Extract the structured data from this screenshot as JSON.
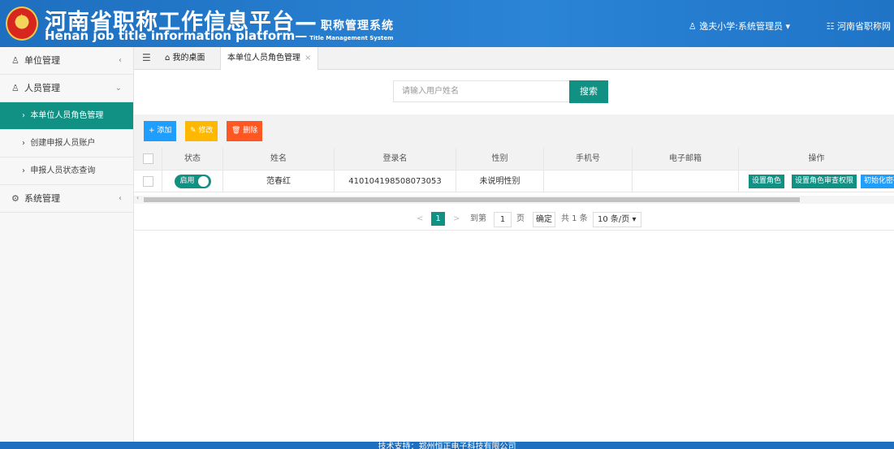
{
  "header": {
    "title_cn": "河南省职称工作信息平台—",
    "subtitle_cn": "职称管理系统",
    "title_en": "Henan job title information platform—",
    "subtitle_en": "Title Management System",
    "user": "逸夫小学:系统管理员",
    "site_link": "河南省职称网"
  },
  "sidebar": {
    "items": [
      {
        "label": "单位管理",
        "icon": "user-icon",
        "arrow": "‹"
      },
      {
        "label": "人员管理",
        "icon": "user-icon",
        "arrow": "⌄"
      },
      {
        "label": "本单位人员角色管理",
        "active": true
      },
      {
        "label": "创建申报人员账户"
      },
      {
        "label": "申报人员状态查询"
      },
      {
        "label": "系统管理",
        "icon": "settings-icon",
        "arrow": "‹"
      }
    ]
  },
  "tabs": {
    "home": "我的桌面",
    "current": "本单位人员角色管理",
    "close": "×"
  },
  "search": {
    "placeholder": "请输入用户姓名",
    "button": "搜索"
  },
  "toolbar": {
    "add": "+ 添加",
    "edit": "✎ 修改",
    "delete": "🗑 删除"
  },
  "table": {
    "headers": [
      "状态",
      "姓名",
      "登录名",
      "性别",
      "手机号",
      "电子邮箱",
      "操作"
    ],
    "rows": [
      {
        "status": "启用",
        "name": "范春红",
        "login": "410104198508073053",
        "gender": "未说明性别",
        "phone": "",
        "email": "",
        "actions": [
          "设置角色",
          "设置角色审查权限",
          "初始化密码"
        ]
      }
    ]
  },
  "pager": {
    "prev": "<",
    "current": "1",
    "next": ">",
    "goto": "到第",
    "page_input": "1",
    "page_unit": "页",
    "confirm": "确定",
    "total": "共 1 条",
    "page_size": "10 条/页 ▾"
  },
  "footer": {
    "text": "技术支持：郑州恒正电子科技有限公司"
  },
  "colors": {
    "header": "#1e6fbf",
    "primary": "#119184",
    "add": "#1e9fff",
    "edit": "#ffb800",
    "delete": "#ff5722",
    "action_blue": "#1e9fff"
  }
}
